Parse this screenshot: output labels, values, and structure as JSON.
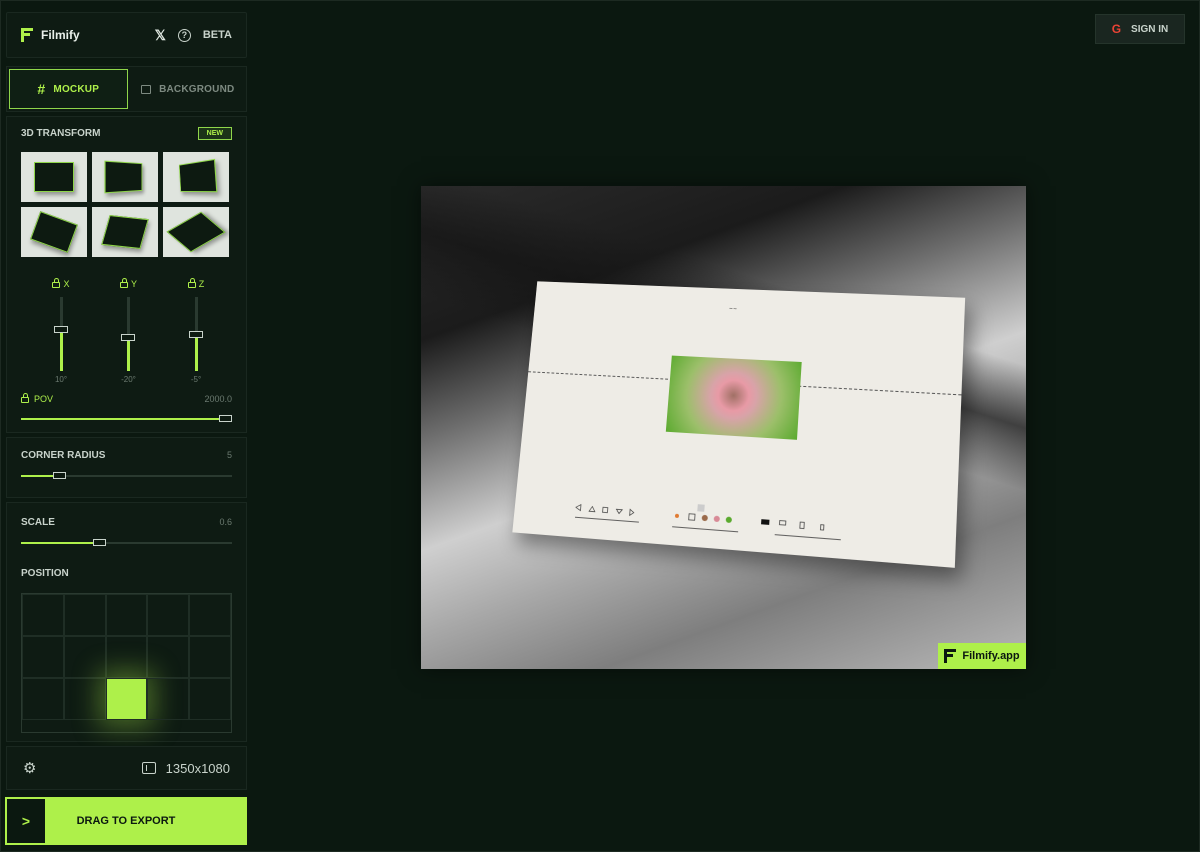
{
  "app": {
    "name": "Filmify",
    "beta": "BETA"
  },
  "tabs": [
    {
      "label": "MOCKUP",
      "active": true
    },
    {
      "label": "BACKGROUND",
      "active": false
    }
  ],
  "transform": {
    "title": "3D TRANSFORM",
    "badge": "NEW",
    "axes": [
      {
        "label": "X",
        "value": "10°",
        "level": 0.55
      },
      {
        "label": "Y",
        "value": "-20°",
        "level": 0.45
      },
      {
        "label": "Z",
        "value": "-5°",
        "level": 0.48
      }
    ],
    "pov": {
      "label": "POV",
      "value": "2000.0",
      "level": 1.0
    }
  },
  "corner_radius": {
    "label": "CORNER RADIUS",
    "value": "5",
    "level": 0.18
  },
  "scale": {
    "label": "SCALE",
    "value": "0.6",
    "level": 0.37
  },
  "position": {
    "label": "POSITION",
    "selected_cell": {
      "col": 3,
      "row": 3
    }
  },
  "bottom": {
    "size": "1350x1080"
  },
  "export": {
    "label": "DRAG TO EXPORT"
  },
  "signin": {
    "label": "SIGN IN"
  },
  "watermark": {
    "text": "Filmify.app"
  },
  "colors": {
    "accent": "#aef04a",
    "bg": "#0b1810",
    "panel": "#0e1b13"
  }
}
